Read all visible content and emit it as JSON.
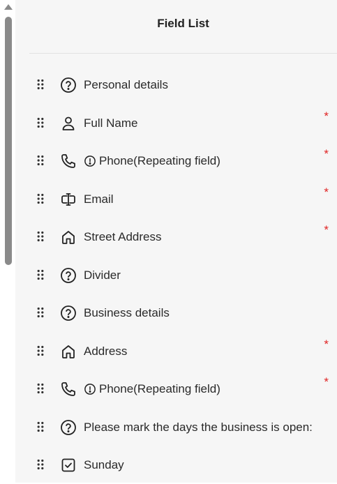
{
  "panel": {
    "title": "Field List"
  },
  "fields": [
    {
      "label": "Personal details",
      "icon": "help-circle-icon",
      "required": false,
      "repeating_icon": false
    },
    {
      "label": "Full Name",
      "icon": "user-icon",
      "required": true,
      "repeating_icon": false
    },
    {
      "label": "Phone(Repeating field)",
      "icon": "phone-icon",
      "required": true,
      "repeating_icon": true
    },
    {
      "label": "Email",
      "icon": "email-field-icon",
      "required": true,
      "repeating_icon": false
    },
    {
      "label": "Street Address",
      "icon": "home-icon",
      "required": true,
      "repeating_icon": false
    },
    {
      "label": "Divider",
      "icon": "help-circle-icon",
      "required": false,
      "repeating_icon": false
    },
    {
      "label": "Business details",
      "icon": "help-circle-icon",
      "required": false,
      "repeating_icon": false
    },
    {
      "label": "Address",
      "icon": "home-icon",
      "required": true,
      "repeating_icon": false
    },
    {
      "label": "Phone(Repeating field)",
      "icon": "phone-icon",
      "required": true,
      "repeating_icon": true
    },
    {
      "label": "Please mark the days the business is open:",
      "icon": "help-circle-icon",
      "required": false,
      "repeating_icon": false
    },
    {
      "label": "Sunday",
      "icon": "checkbox-icon",
      "required": false,
      "repeating_icon": false
    }
  ],
  "required_symbol": "*",
  "colors": {
    "panel_background": "#f6f6f6",
    "required": "#e02424",
    "scrollbar": "#8a8a8a"
  }
}
